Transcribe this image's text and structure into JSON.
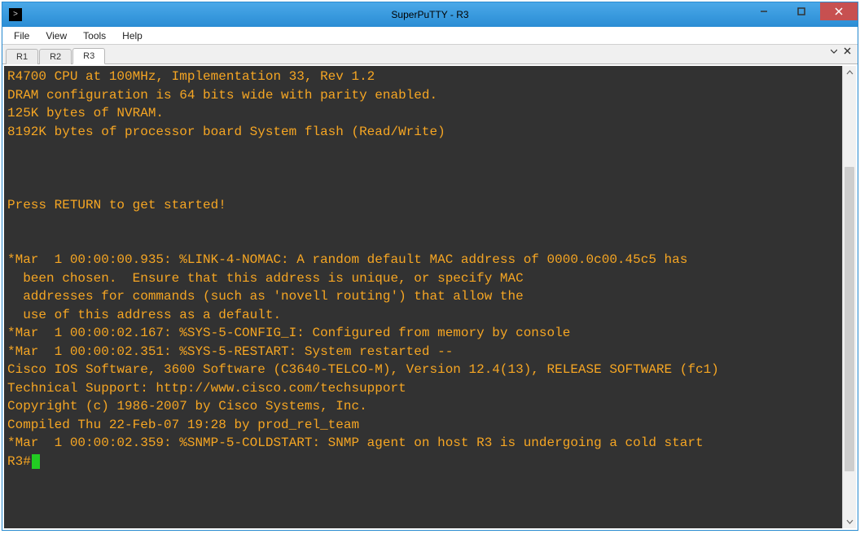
{
  "window": {
    "title": "SuperPuTTY - R3"
  },
  "menu": {
    "items": [
      "File",
      "View",
      "Tools",
      "Help"
    ]
  },
  "tabs": {
    "items": [
      "R1",
      "R2",
      "R3"
    ],
    "active_index": 2
  },
  "terminal": {
    "lines": [
      "R4700 CPU at 100MHz, Implementation 33, Rev 1.2",
      "DRAM configuration is 64 bits wide with parity enabled.",
      "125K bytes of NVRAM.",
      "8192K bytes of processor board System flash (Read/Write)",
      "",
      "",
      "",
      "Press RETURN to get started!",
      "",
      "",
      "*Mar  1 00:00:00.935: %LINK-4-NOMAC: A random default MAC address of 0000.0c00.45c5 has",
      "  been chosen.  Ensure that this address is unique, or specify MAC",
      "  addresses for commands (such as 'novell routing') that allow the",
      "  use of this address as a default.",
      "*Mar  1 00:00:02.167: %SYS-5-CONFIG_I: Configured from memory by console",
      "*Mar  1 00:00:02.351: %SYS-5-RESTART: System restarted --",
      "Cisco IOS Software, 3600 Software (C3640-TELCO-M), Version 12.4(13), RELEASE SOFTWARE (fc1)",
      "Technical Support: http://www.cisco.com/techsupport",
      "Copyright (c) 1986-2007 by Cisco Systems, Inc.",
      "Compiled Thu 22-Feb-07 19:28 by prod_rel_team",
      "*Mar  1 00:00:02.359: %SNMP-5-COLDSTART: SNMP agent on host R3 is undergoing a cold start"
    ],
    "prompt": "R3#"
  }
}
